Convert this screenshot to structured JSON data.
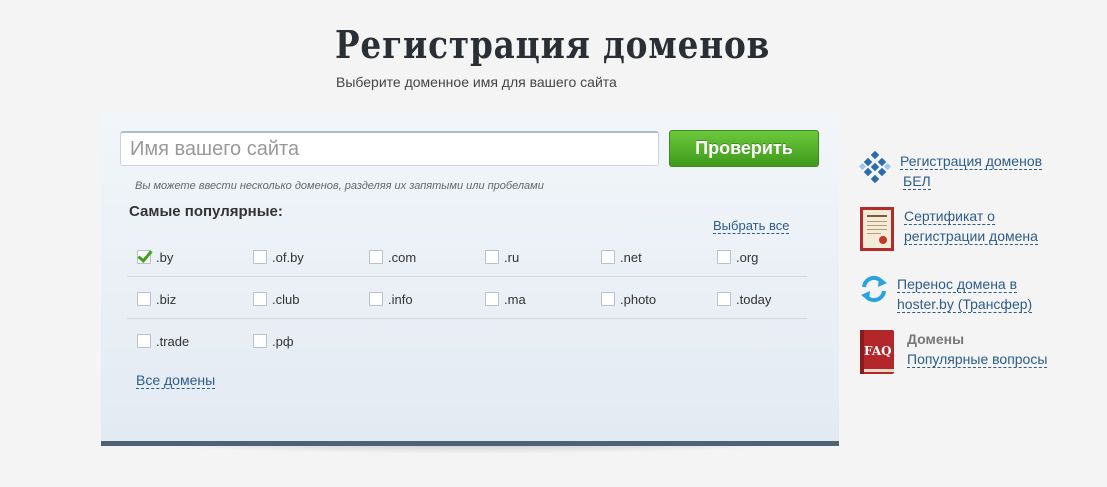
{
  "header": {
    "title": "Регистрация доменов",
    "subtitle": "Выберите доменное имя для вашего сайта"
  },
  "search": {
    "placeholder": "Имя вашего сайта",
    "value": "",
    "button_label": "Проверить",
    "hint": "Вы можете ввести несколько доменов, разделяя их запятыми или пробелами"
  },
  "popular": {
    "heading": "Самые популярные:",
    "select_all": "Выбрать все",
    "all_domains": "Все домены",
    "zones": [
      {
        "label": ".by",
        "checked": true
      },
      {
        "label": ".of.by",
        "checked": false
      },
      {
        "label": ".com",
        "checked": false
      },
      {
        "label": ".ru",
        "checked": false
      },
      {
        "label": ".net",
        "checked": false
      },
      {
        "label": ".org",
        "checked": false
      },
      {
        "label": ".biz",
        "checked": false
      },
      {
        "label": ".club",
        "checked": false
      },
      {
        "label": ".info",
        "checked": false
      },
      {
        "label": ".ma",
        "checked": false
      },
      {
        "label": ".photo",
        "checked": false
      },
      {
        "label": ".today",
        "checked": false
      },
      {
        "label": ".trade",
        "checked": false
      },
      {
        "label": ".рф",
        "checked": false
      }
    ]
  },
  "sidebar": {
    "items": [
      {
        "icon": "bel-domain-icon",
        "line1": "Регистрация доменов",
        "line2": "БЕЛ"
      },
      {
        "icon": "certificate-icon",
        "line1": "Сертификат о",
        "line2": "регистрации домена"
      },
      {
        "icon": "transfer-icon",
        "line1": "Перенос домена в",
        "line2": "hoster.by (Трансфер)"
      },
      {
        "icon": "faq-book-icon",
        "title": "Домены",
        "link": "Популярные вопросы",
        "icon_text": "FAQ"
      }
    ]
  },
  "colors": {
    "accent_green": "#4caf27",
    "link_blue": "#2c5c8a",
    "panel_border": "#4f6273"
  }
}
